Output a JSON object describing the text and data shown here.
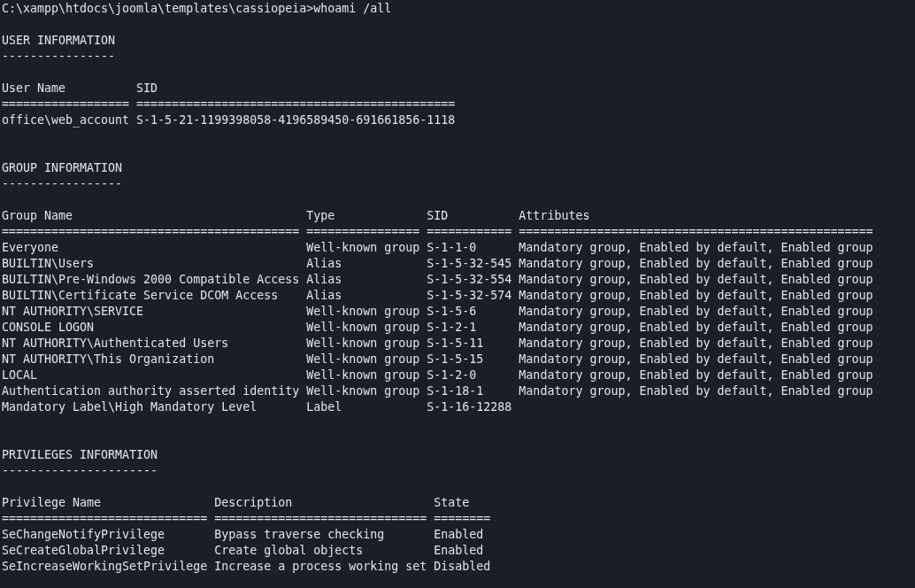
{
  "terminal": {
    "command_line": "C:\\xampp\\htdocs\\joomla\\templates\\cassiopeia>whoami /all",
    "sections": [
      {
        "title": "USER INFORMATION",
        "underline": "----------------",
        "columns": [
          {
            "label": "User Name",
            "rule": "=================="
          },
          {
            "label": "SID",
            "rule": "============================================="
          }
        ],
        "rows": [
          [
            "office\\web_account",
            "S-1-5-21-1199398058-4196589450-691661856-1118"
          ]
        ]
      },
      {
        "title": "GROUP INFORMATION",
        "underline": "-----------------",
        "columns": [
          {
            "label": "Group Name",
            "rule": "=========================================="
          },
          {
            "label": "Type",
            "rule": "================"
          },
          {
            "label": "SID",
            "rule": "============"
          },
          {
            "label": "Attributes",
            "rule": "=================================================="
          }
        ],
        "rows": [
          [
            "Everyone",
            "Well-known group",
            "S-1-1-0",
            "Mandatory group, Enabled by default, Enabled group"
          ],
          [
            "BUILTIN\\Users",
            "Alias",
            "S-1-5-32-545",
            "Mandatory group, Enabled by default, Enabled group"
          ],
          [
            "BUILTIN\\Pre-Windows 2000 Compatible Access",
            "Alias",
            "S-1-5-32-554",
            "Mandatory group, Enabled by default, Enabled group"
          ],
          [
            "BUILTIN\\Certificate Service DCOM Access",
            "Alias",
            "S-1-5-32-574",
            "Mandatory group, Enabled by default, Enabled group"
          ],
          [
            "NT AUTHORITY\\SERVICE",
            "Well-known group",
            "S-1-5-6",
            "Mandatory group, Enabled by default, Enabled group"
          ],
          [
            "CONSOLE LOGON",
            "Well-known group",
            "S-1-2-1",
            "Mandatory group, Enabled by default, Enabled group"
          ],
          [
            "NT AUTHORITY\\Authenticated Users",
            "Well-known group",
            "S-1-5-11",
            "Mandatory group, Enabled by default, Enabled group"
          ],
          [
            "NT AUTHORITY\\This Organization",
            "Well-known group",
            "S-1-5-15",
            "Mandatory group, Enabled by default, Enabled group"
          ],
          [
            "LOCAL",
            "Well-known group",
            "S-1-2-0",
            "Mandatory group, Enabled by default, Enabled group"
          ],
          [
            "Authentication authority asserted identity",
            "Well-known group",
            "S-1-18-1",
            "Mandatory group, Enabled by default, Enabled group"
          ],
          [
            "Mandatory Label\\High Mandatory Level",
            "Label",
            "S-1-16-12288"
          ]
        ]
      },
      {
        "title": "PRIVILEGES INFORMATION",
        "underline": "----------------------",
        "columns": [
          {
            "label": "Privilege Name",
            "rule": "============================="
          },
          {
            "label": "Description",
            "rule": "=============================="
          },
          {
            "label": "State",
            "rule": "========"
          }
        ],
        "rows": [
          [
            "SeChangeNotifyPrivilege",
            "Bypass traverse checking",
            "Enabled"
          ],
          [
            "SeCreateGlobalPrivilege",
            "Create global objects",
            "Enabled"
          ],
          [
            "SeIncreaseWorkingSetPrivilege",
            "Increase a process working set",
            "Disabled"
          ]
        ]
      }
    ]
  }
}
